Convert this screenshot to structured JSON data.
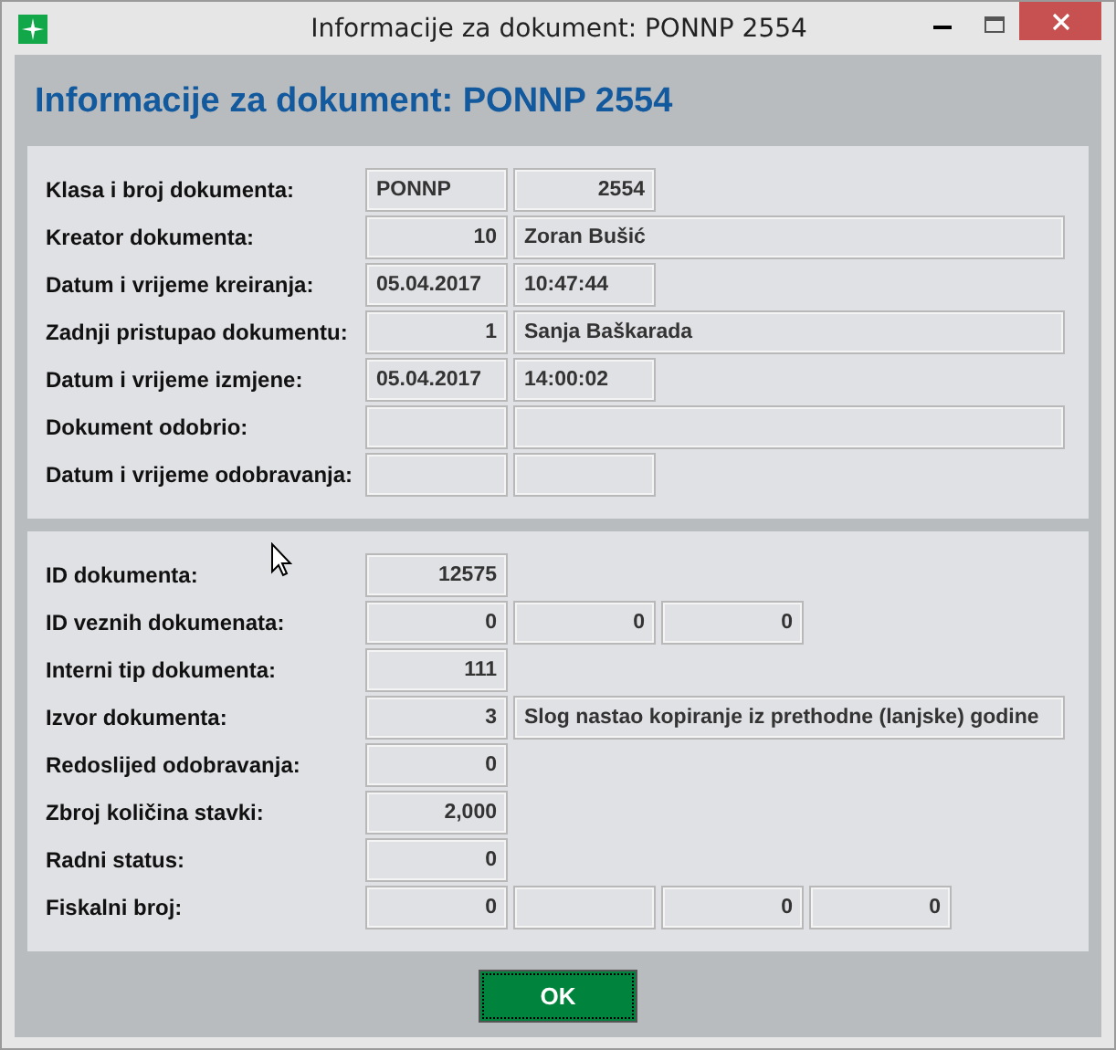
{
  "window": {
    "title": "Informacije za dokument: PONNP 2554"
  },
  "heading": "Informacije za dokument: PONNP 2554",
  "sections": [
    {
      "rows": [
        {
          "label": "Klasa i broj dokumenta:",
          "fields": [
            {
              "kind": "short",
              "numeric": false,
              "value": "PONNP"
            },
            {
              "kind": "short",
              "numeric": true,
              "value": "2554"
            }
          ]
        },
        {
          "label": "Kreator dokumenta:",
          "fields": [
            {
              "kind": "short",
              "numeric": true,
              "value": "10"
            },
            {
              "kind": "wide",
              "numeric": false,
              "value": "Zoran Bušić"
            }
          ]
        },
        {
          "label": "Datum i vrijeme kreiranja:",
          "fields": [
            {
              "kind": "short",
              "numeric": false,
              "value": "05.04.2017"
            },
            {
              "kind": "short",
              "numeric": false,
              "value": "10:47:44"
            }
          ]
        },
        {
          "label": "Zadnji pristupao dokumentu:",
          "fields": [
            {
              "kind": "short",
              "numeric": true,
              "value": "1"
            },
            {
              "kind": "wide",
              "numeric": false,
              "value": "Sanja Baškarada"
            }
          ]
        },
        {
          "label": "Datum i vrijeme izmjene:",
          "fields": [
            {
              "kind": "short",
              "numeric": false,
              "value": "05.04.2017"
            },
            {
              "kind": "short",
              "numeric": false,
              "value": "14:00:02"
            }
          ]
        },
        {
          "label": "Dokument odobrio:",
          "fields": [
            {
              "kind": "short"
            },
            {
              "kind": "wide"
            }
          ]
        },
        {
          "label": "Datum i vrijeme odobravanja:",
          "fields": [
            {
              "kind": "short"
            },
            {
              "kind": "short"
            }
          ]
        }
      ]
    },
    {
      "rows": [
        {
          "label": "ID dokumenta:",
          "fields": [
            {
              "kind": "short",
              "numeric": true,
              "value": "12575"
            }
          ]
        },
        {
          "label": "ID veznih dokumenata:",
          "fields": [
            {
              "kind": "short",
              "numeric": true,
              "value": "0"
            },
            {
              "kind": "short",
              "numeric": true,
              "value": "0"
            },
            {
              "kind": "short",
              "numeric": true,
              "value": "0"
            }
          ]
        },
        {
          "label": "Interni tip dokumenta:",
          "fields": [
            {
              "kind": "short",
              "numeric": true,
              "value": "111"
            }
          ]
        },
        {
          "label": "Izvor dokumenta:",
          "fields": [
            {
              "kind": "short",
              "numeric": true,
              "value": "3"
            },
            {
              "kind": "wide",
              "numeric": false,
              "value": "Slog nastao kopiranje iz prethodne (lanjske) godine"
            }
          ]
        },
        {
          "label": "Redoslijed odobravanja:",
          "fields": [
            {
              "kind": "short",
              "numeric": true,
              "value": "0"
            }
          ]
        },
        {
          "label": "Zbroj količina stavki:",
          "fields": [
            {
              "kind": "short",
              "numeric": true,
              "value": "2,000"
            }
          ]
        },
        {
          "label": "Radni status:",
          "fields": [
            {
              "kind": "short",
              "numeric": true,
              "value": "0"
            }
          ]
        },
        {
          "label": "Fiskalni broj:",
          "fields": [
            {
              "kind": "short",
              "numeric": true,
              "value": "0"
            },
            {
              "kind": "short"
            },
            {
              "kind": "short",
              "numeric": true,
              "value": "0"
            },
            {
              "kind": "short",
              "numeric": true,
              "value": "0"
            }
          ]
        }
      ]
    }
  ],
  "ok_button": "OK"
}
